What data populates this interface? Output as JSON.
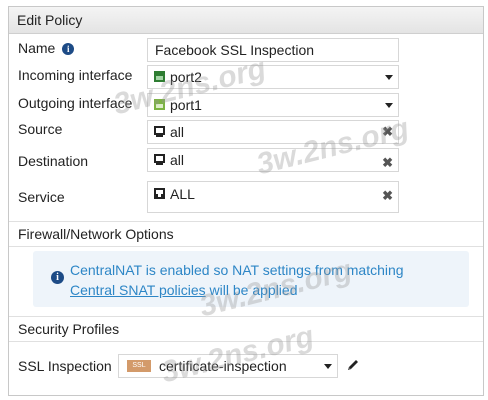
{
  "dialog": {
    "title": "Edit Policy"
  },
  "fields": {
    "name": {
      "label": "Name",
      "value": "Facebook SSL Inspection"
    },
    "incoming": {
      "label": "Incoming interface",
      "value": "port2"
    },
    "outgoing": {
      "label": "Outgoing interface",
      "value": "port1"
    },
    "source": {
      "label": "Source",
      "value": "all"
    },
    "destination": {
      "label": "Destination",
      "value": "all"
    },
    "service": {
      "label": "Service",
      "value": "ALL"
    }
  },
  "firewall_section": {
    "title": "Firewall/Network Options",
    "notice_line1": "CentralNAT is enabled so NAT settings from matching",
    "notice_link": "Central SNAT policies",
    "notice_suffix": " will be applied"
  },
  "security_section": {
    "title": "Security Profiles"
  },
  "ssl_inspection": {
    "label": "SSL Inspection",
    "badge": "SSL",
    "value": "certificate-inspection"
  },
  "watermarks": [
    "3w.2ns.org",
    "3w.2ns.org",
    "3w.2ns.org",
    "3w.2ns.org"
  ],
  "icons": {
    "info": "info-icon",
    "interface": "network-interface-icon",
    "address": "address-icon",
    "service": "service-icon",
    "remove": "remove-icon",
    "dropdown": "chevron-down-icon",
    "edit": "pencil-icon"
  },
  "colors": {
    "link": "#2d86c6",
    "notice_bg": "#eef4fa",
    "info_icon": "#1d4b86",
    "ssl_badge": "#d39a6a"
  }
}
